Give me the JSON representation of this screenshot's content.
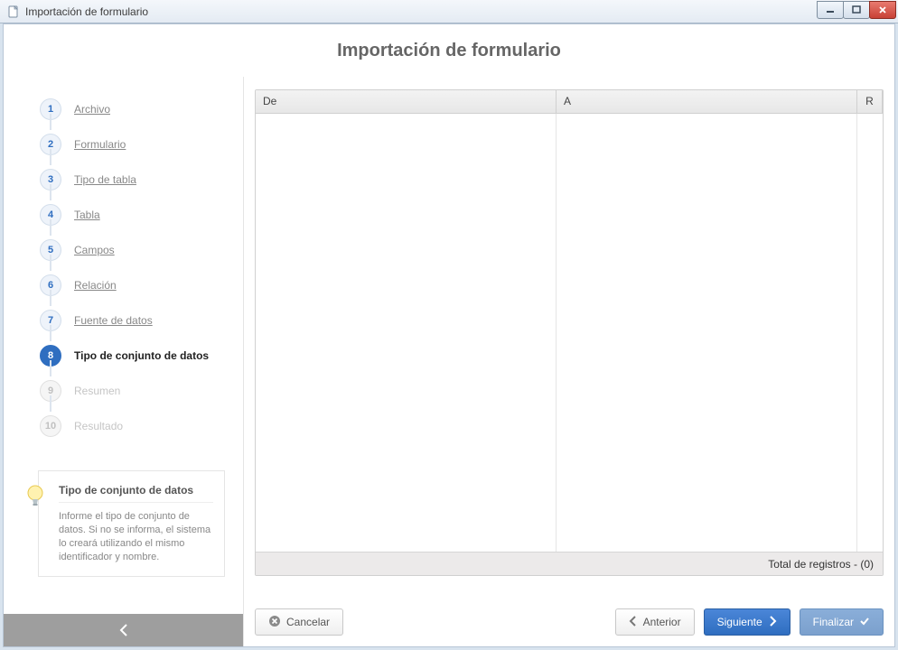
{
  "window": {
    "title": "Importación de formulario"
  },
  "header": {
    "title": "Importación de formulario"
  },
  "steps": [
    {
      "num": "1",
      "label": "Archivo",
      "state": "done"
    },
    {
      "num": "2",
      "label": "Formulario",
      "state": "done"
    },
    {
      "num": "3",
      "label": "Tipo de tabla",
      "state": "done"
    },
    {
      "num": "4",
      "label": "Tabla",
      "state": "done"
    },
    {
      "num": "5",
      "label": "Campos",
      "state": "done"
    },
    {
      "num": "6",
      "label": "Relación",
      "state": "done"
    },
    {
      "num": "7",
      "label": "Fuente de datos",
      "state": "done"
    },
    {
      "num": "8",
      "label": "Tipo de conjunto de datos",
      "state": "active"
    },
    {
      "num": "9",
      "label": "Resumen",
      "state": "future"
    },
    {
      "num": "10",
      "label": "Resultado",
      "state": "future"
    }
  ],
  "hint": {
    "title": "Tipo de conjunto de datos",
    "body": "Informe el tipo de conjunto de datos. Si no se informa, el sistema lo creará utilizando el mismo identificador y nombre."
  },
  "table": {
    "columns": {
      "de": "De",
      "a": "A",
      "r": "R"
    },
    "footer": "Total de registros  - (0)"
  },
  "buttons": {
    "cancel": "Cancelar",
    "previous": "Anterior",
    "next": "Siguiente",
    "finish": "Finalizar"
  }
}
